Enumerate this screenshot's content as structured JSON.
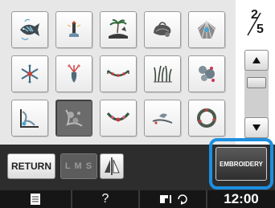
{
  "patterns": {
    "items": [
      {
        "name": "fish-pattern-icon",
        "selected": false
      },
      {
        "name": "lighthouse-pattern-icon",
        "selected": false
      },
      {
        "name": "palm-island-pattern-icon",
        "selected": false
      },
      {
        "name": "shell-pattern-icon",
        "selected": false
      },
      {
        "name": "shell-scallop-pattern-icon",
        "selected": false
      },
      {
        "name": "snowflake-pattern-icon",
        "selected": false
      },
      {
        "name": "vase-pattern-icon",
        "selected": false
      },
      {
        "name": "garland-pattern-icon",
        "selected": false
      },
      {
        "name": "grass-pattern-icon",
        "selected": false
      },
      {
        "name": "floral-spray-pattern-icon",
        "selected": false
      },
      {
        "name": "corner-lace-pattern-icon",
        "selected": false
      },
      {
        "name": "floral-corner-pattern-icon",
        "selected": true
      },
      {
        "name": "swag-pattern-icon",
        "selected": false
      },
      {
        "name": "bird-branch-pattern-icon",
        "selected": false
      },
      {
        "name": "wreath-pattern-icon",
        "selected": false
      }
    ]
  },
  "pager": {
    "current": "2",
    "total": "5"
  },
  "buttons": {
    "return_label": "RETURN",
    "size_label": "L M S",
    "embroidery_label": "EMBROIDERY"
  },
  "status": {
    "help": "?",
    "clock": "12:00"
  },
  "colors": {
    "highlight": "#1d8fe0",
    "bar": "#2d2d2d",
    "status_bar": "#161616"
  }
}
